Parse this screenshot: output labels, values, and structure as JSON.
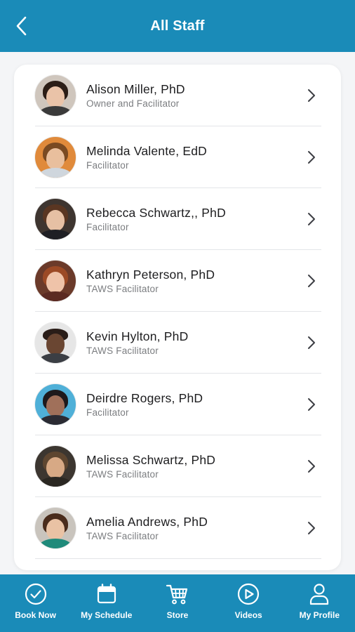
{
  "header": {
    "title": "All Staff"
  },
  "staff": [
    {
      "name": "Alison Miller, PhD",
      "role": "Owner and Facilitator"
    },
    {
      "name": "Melinda Valente, EdD",
      "role": "Facilitator"
    },
    {
      "name": "Rebecca Schwartz,, PhD",
      "role": "Facilitator"
    },
    {
      "name": "Kathryn Peterson, PhD",
      "role": "TAWS Facilitator"
    },
    {
      "name": "Kevin Hylton, PhD",
      "role": "TAWS Facilitator"
    },
    {
      "name": "Deirdre Rogers, PhD",
      "role": "Facilitator"
    },
    {
      "name": "Melissa Schwartz, PhD",
      "role": "TAWS Facilitator"
    },
    {
      "name": "Amelia Andrews, PhD",
      "role": "TAWS Facilitator"
    }
  ],
  "tabs": [
    {
      "label": "Book Now",
      "icon": "check-circle-icon"
    },
    {
      "label": "My Schedule",
      "icon": "calendar-icon"
    },
    {
      "label": "Store",
      "icon": "cart-icon"
    },
    {
      "label": "Videos",
      "icon": "play-circle-icon"
    },
    {
      "label": "My Profile",
      "icon": "person-icon"
    }
  ],
  "colors": {
    "brand": "#1a8bb8",
    "text": "#1d1d1f",
    "subtext": "#7b7d80"
  }
}
